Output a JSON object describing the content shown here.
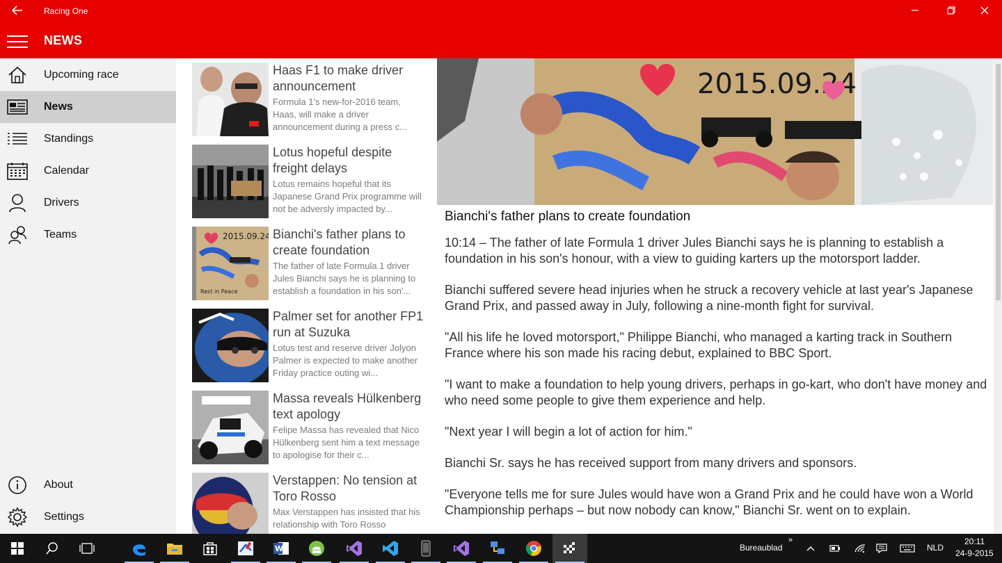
{
  "window": {
    "app_title": "Racing One",
    "back_icon": "arrow-left-icon",
    "minimize_icon": "minimize-icon",
    "maximize_icon": "restore-icon",
    "close_icon": "close-icon"
  },
  "header": {
    "title": "NEWS",
    "menu_icon": "hamburger-icon"
  },
  "sidebar": {
    "items": [
      {
        "label": "Upcoming race",
        "icon": "home-icon",
        "active": false
      },
      {
        "label": "News",
        "icon": "newspaper-icon",
        "active": true
      },
      {
        "label": "Standings",
        "icon": "list-icon",
        "active": false
      },
      {
        "label": "Calendar",
        "icon": "calendar-icon",
        "active": false
      },
      {
        "label": "Drivers",
        "icon": "person-icon",
        "active": false
      },
      {
        "label": "Teams",
        "icon": "people-icon",
        "active": false
      }
    ],
    "bottom_items": [
      {
        "label": "About",
        "icon": "info-icon"
      },
      {
        "label": "Settings",
        "icon": "gear-icon"
      }
    ]
  },
  "news": [
    {
      "title": "Haas F1 to make driver announcement",
      "summary": "Formula 1's new-for-2016 team, Haas, will make a driver announcement during a press c..."
    },
    {
      "title": "Lotus hopeful despite freight delays",
      "summary": "Lotus remains hopeful that its Japanese Grand Prix programme will not be adversly impacted by..."
    },
    {
      "title": "Bianchi's father plans to create foundation",
      "summary": "The father of late Formula 1 driver Jules Bianchi says he is planning to establish a foundation in his son'..."
    },
    {
      "title": "Palmer set for another FP1 run at Suzuka",
      "summary": "Lotus test and reserve driver Jolyon Palmer is expected to make another Friday practice outing wi..."
    },
    {
      "title": "Massa reveals Hülkenberg text apology",
      "summary": "Felipe Massa has revealed that Nico Hülkenberg sent him a text message to apologise for their c..."
    },
    {
      "title": "Verstappen: No tension at Toro Rosso",
      "summary": "Max Verstappen has insisted that his relationship with Toro Rosso"
    }
  ],
  "article": {
    "image_text": "2015.09.24",
    "title": "Bianchi's father plans to create foundation",
    "paragraphs": [
      "10:14 –    The father of late Formula 1 driver Jules Bianchi says he is planning to establish a foundation in his son's honour, with a view to guiding karters up the motorsport ladder.",
      "Bianchi suffered severe head injuries when he struck a recovery vehicle at last year's Japanese Grand Prix, and passed away in July, following a nine-month fight for survival.",
      "\"All his life he loved motorsport,\" Philippe Bianchi, who managed a karting track in Southern France where his son made his racing debut, explained to BBC Sport.",
      "\"I want to make a foundation to help young drivers, perhaps in go-kart, who don't have money and who need some people to give them experience and help.",
      "\"Next year I will begin a lot of action for him.\"",
      "Bianchi Sr. says he has received support from many drivers and sponsors.",
      "\"Everyone tells me for sure Jules would have won a Grand Prix and he could have won a World Championship perhaps – but now nobody can know,\" Bianchi Sr. went on to explain."
    ]
  },
  "taskbar": {
    "desktop_label": "Bureaublad",
    "language": "NLD",
    "time": "20:11",
    "date": "24-9-2015"
  },
  "colors": {
    "accent": "#e60000",
    "sidebar": "#f2f2f2",
    "active_nav": "#cfcfcf",
    "taskbar": "#141414"
  }
}
